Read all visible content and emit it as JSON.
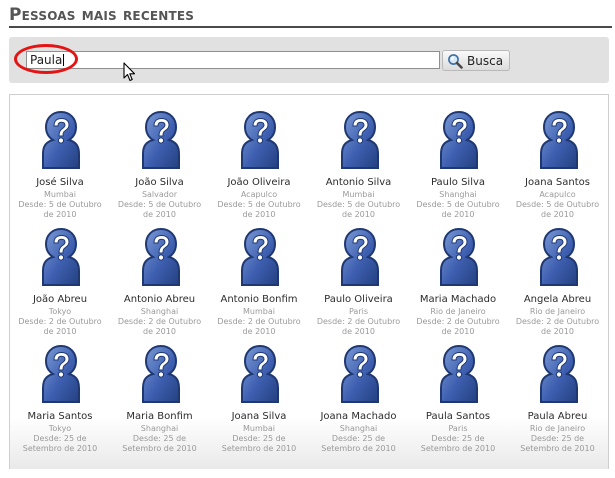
{
  "header": {
    "title": "Pessoas mais recentes"
  },
  "search": {
    "value": "Paula",
    "button_label": "Busca"
  },
  "people": [
    {
      "name": "José Silva",
      "city": "Mumbai",
      "since": "Desde: 5 de Outubro de 2010"
    },
    {
      "name": "João Silva",
      "city": "Salvador",
      "since": "Desde: 5 de Outubro de 2010"
    },
    {
      "name": "João Oliveira",
      "city": "Acapulco",
      "since": "Desde: 5 de Outubro de 2010"
    },
    {
      "name": "Antonio Silva",
      "city": "Mumbai",
      "since": "Desde: 5 de Outubro de 2010"
    },
    {
      "name": "Paulo Silva",
      "city": "Shanghai",
      "since": "Desde: 5 de Outubro de 2010"
    },
    {
      "name": "Joana Santos",
      "city": "Acapulco",
      "since": "Desde: 5 de Outubro de 2010"
    },
    {
      "name": "João Abreu",
      "city": "Tokyo",
      "since": "Desde: 2 de Outubro de 2010"
    },
    {
      "name": "Antonio Abreu",
      "city": "Shanghai",
      "since": "Desde: 2 de Outubro de 2010"
    },
    {
      "name": "Antonio Bonfim",
      "city": "Mumbai",
      "since": "Desde: 2 de Outubro de 2010"
    },
    {
      "name": "Paulo Oliveira",
      "city": "Paris",
      "since": "Desde: 2 de Outubro de 2010"
    },
    {
      "name": "Maria Machado",
      "city": "Rio de Janeiro",
      "since": "Desde: 2 de Outubro de 2010"
    },
    {
      "name": "Angela Abreu",
      "city": "Rio de Janeiro",
      "since": "Desde: 2 de Outubro de 2010"
    },
    {
      "name": "Maria Santos",
      "city": "Tokyo",
      "since": "Desde: 25 de Setembro de 2010"
    },
    {
      "name": "Maria Bonfim",
      "city": "Shanghai",
      "since": "Desde: 25 de Setembro de 2010"
    },
    {
      "name": "Joana Silva",
      "city": "Mumbai",
      "since": "Desde: 25 de Setembro de 2010"
    },
    {
      "name": "Joana Machado",
      "city": "Shanghai",
      "since": "Desde: 25 de Setembro de 2010"
    },
    {
      "name": "Paula Santos",
      "city": "Paris",
      "since": "Desde: 25 de Setembro de 2010"
    },
    {
      "name": "Paula Abreu",
      "city": "Rio de Janeiro",
      "since": "Desde: 25 de Setembro de 2010"
    }
  ],
  "icons": {
    "avatar": "unknown-person-icon",
    "search": "magnifier-icon",
    "cursor": "arrow-cursor-icon"
  },
  "colors": {
    "highlight": "#e41414",
    "avatar_fill": "#3e5fb0",
    "title": "#555555"
  }
}
